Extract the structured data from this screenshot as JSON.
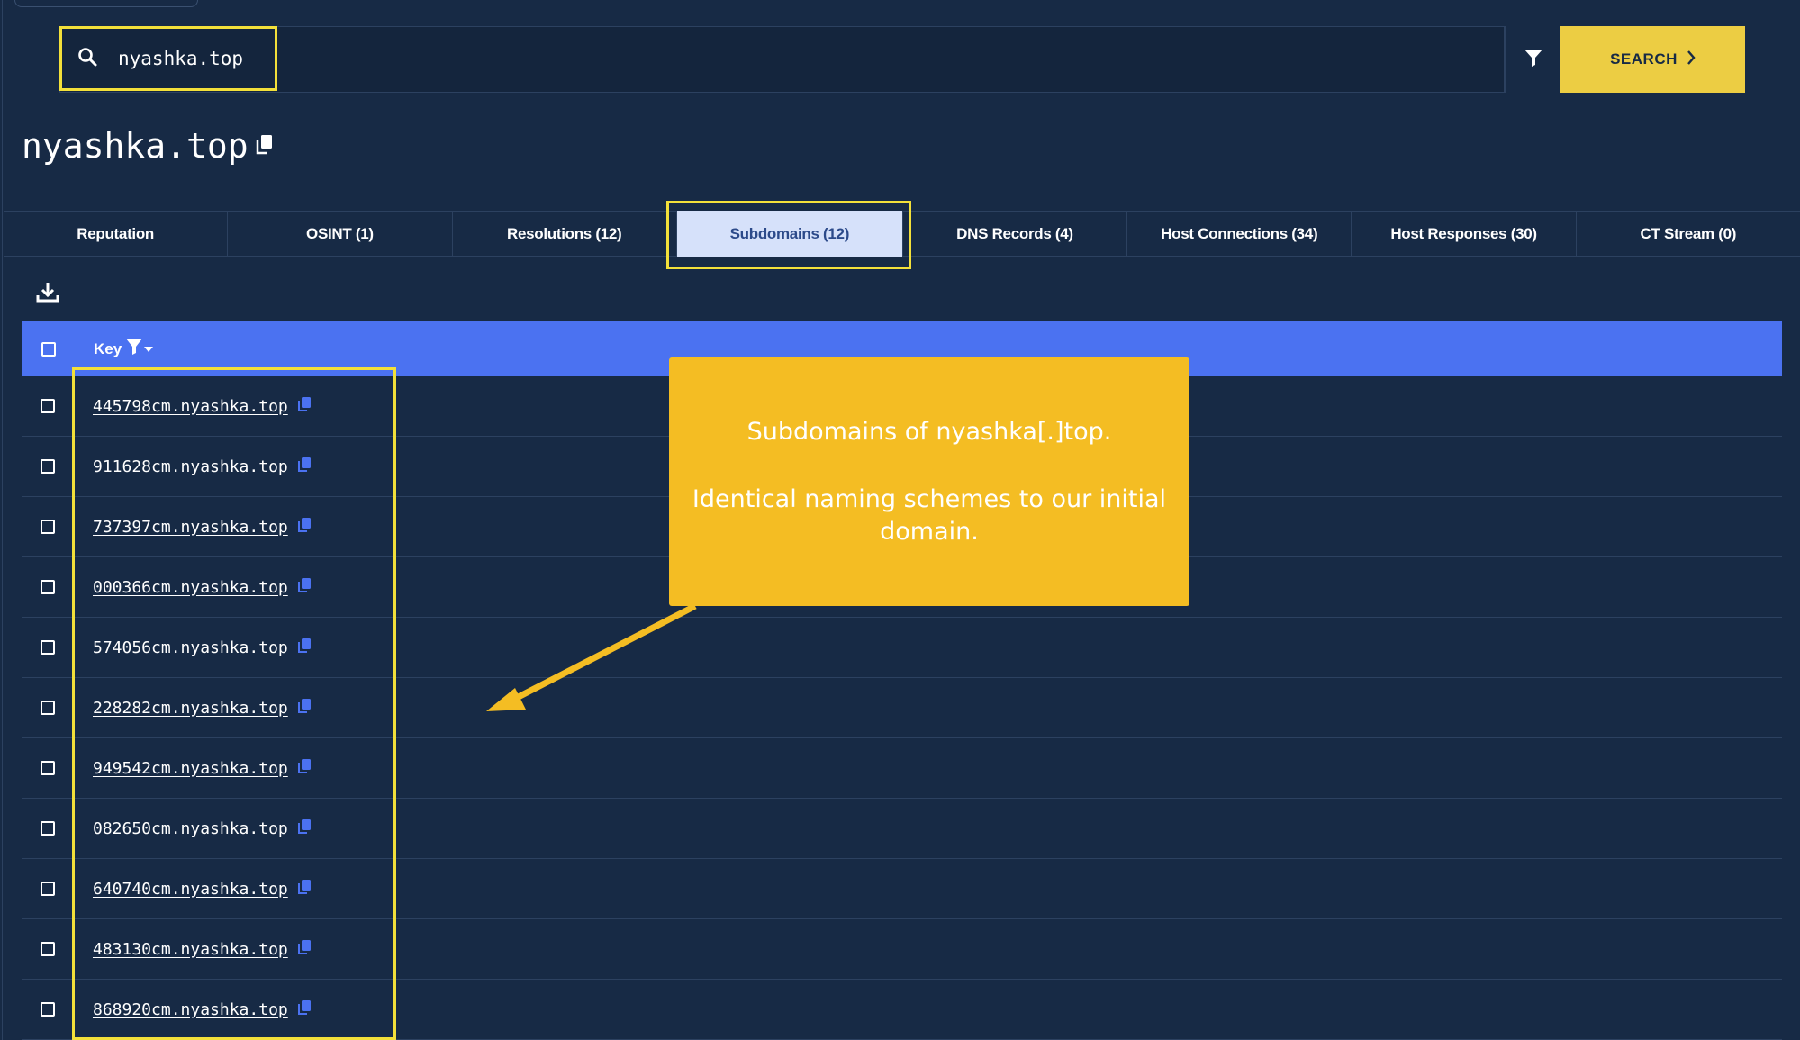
{
  "search": {
    "query": "nyashka.top",
    "button_label": "SEARCH"
  },
  "page": {
    "title": "nyashka.top"
  },
  "tabs": [
    {
      "label": "Reputation"
    },
    {
      "label": "OSINT (1)"
    },
    {
      "label": "Resolutions (12)"
    },
    {
      "label": "Subdomains (12)",
      "active": true
    },
    {
      "label": "DNS Records (4)"
    },
    {
      "label": "Host Connections (34)"
    },
    {
      "label": "Host Responses (30)"
    },
    {
      "label": "CT Stream (0)"
    }
  ],
  "table": {
    "column_key": "Key",
    "rows": [
      "445798cm.nyashka.top",
      "911628cm.nyashka.top",
      "737397cm.nyashka.top",
      "000366cm.nyashka.top",
      "574056cm.nyashka.top",
      "228282cm.nyashka.top",
      "949542cm.nyashka.top",
      "082650cm.nyashka.top",
      "640740cm.nyashka.top",
      "483130cm.nyashka.top",
      "868920cm.nyashka.top"
    ]
  },
  "callout": {
    "line1": "Subdomains of nyashka[.]top.",
    "line2": "Identical naming schemes to our initial domain."
  },
  "colors": {
    "background": "#172a45",
    "header_blue": "#4b72f1",
    "accent_yellow": "#eccd43",
    "highlight_yellow": "#f3e03a",
    "callout_orange": "#f4bd23",
    "active_tab": "#d6e1fa"
  },
  "icons": [
    "search-icon",
    "filter-icon",
    "chevron-right-icon",
    "copy-icon",
    "download-icon",
    "filter-sort-icon"
  ]
}
